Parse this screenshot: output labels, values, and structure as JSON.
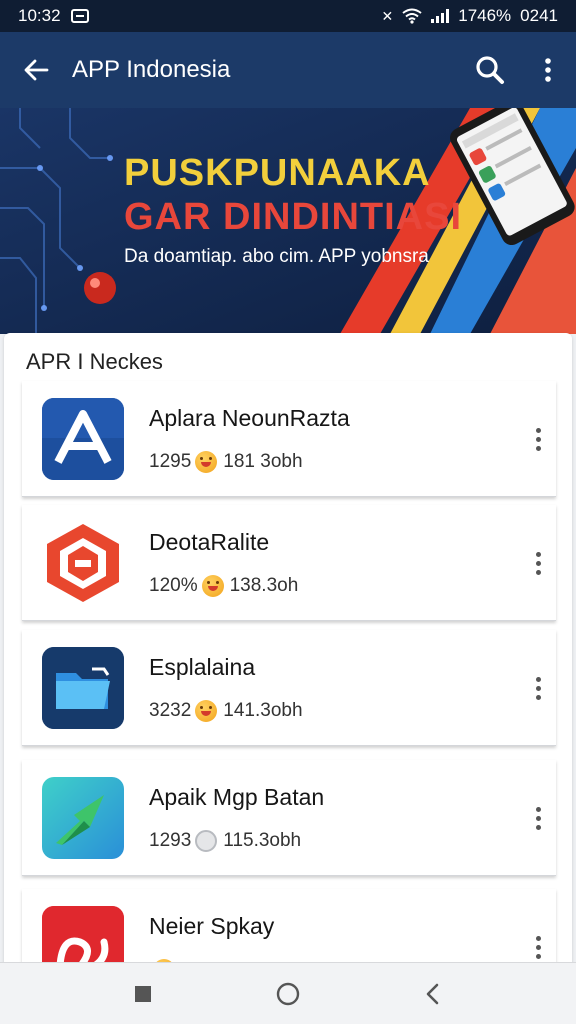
{
  "status_bar": {
    "time": "10:32",
    "battery": "1746%",
    "clock_right": "0241"
  },
  "app_bar": {
    "title": "APP Indonesia"
  },
  "banner": {
    "title_line_1": "PUSKPUNAAKA",
    "title_line_2": "GAR DINDINTIASI",
    "subtitle": "Da doamtiap. abo cim. APP yobnsra",
    "colors": {
      "title_1": "#f2cf3c",
      "title_2": "#e8473b",
      "background": "#13284d"
    }
  },
  "section": {
    "title": "APR I Neckes"
  },
  "apps": [
    {
      "name": "Aplara NeounRazta",
      "rating": "1295",
      "size": "181 3obh",
      "emoji": "happy-face-icon",
      "icon": "a-logo-icon",
      "icon_color": "#1d4f9e"
    },
    {
      "name": "DeotaRalite",
      "rating": "120%",
      "size": "138.3oh",
      "emoji": "happy-face-icon",
      "icon": "hexagon-logo-icon",
      "icon_color": "#e8472e"
    },
    {
      "name": "Esplalaina",
      "rating": "3232",
      "size": "141.3obh",
      "emoji": "happy-face-icon",
      "icon": "folder-logo-icon",
      "icon_color": "#163a6b"
    },
    {
      "name": "Apaik Mgp Batan",
      "rating": "1293",
      "size": "115.3obh",
      "emoji": "neutral-face-icon",
      "icon": "arrow-logo-icon",
      "icon_color": "#2bb8b0"
    },
    {
      "name": "Neier Spkay",
      "rating": "",
      "size": "",
      "emoji": "happy-face-icon",
      "icon": "swirl-logo-icon",
      "icon_color": "#e0282e"
    }
  ],
  "nav": {
    "buttons": [
      "recents-icon",
      "home-icon",
      "back-icon"
    ]
  }
}
